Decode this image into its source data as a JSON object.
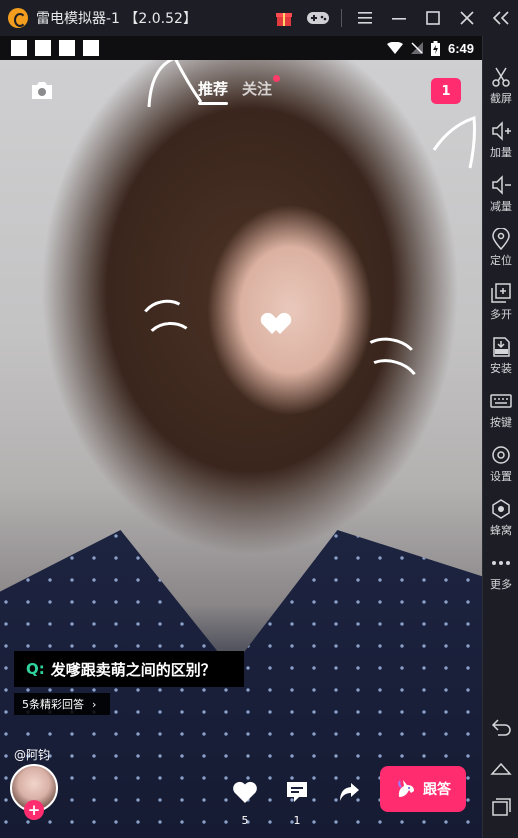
{
  "window": {
    "title": "雷电模拟器-1 【2.0.52】",
    "buttons": [
      "gift-icon",
      "gamepad-icon",
      "menu-icon",
      "minimize-icon",
      "maximize-icon",
      "close-icon"
    ],
    "collapse_icon": "double-chevron-left-icon"
  },
  "statusbar": {
    "time": "6:49",
    "notification_count": 4
  },
  "feed": {
    "tabs": [
      {
        "label": "推荐",
        "active": true
      },
      {
        "label": "关注",
        "active": false,
        "has_dot": true
      }
    ],
    "message_badge": "1"
  },
  "question": {
    "prefix": "Q:",
    "text": "发嗲跟卖萌之间的区别？",
    "answers_link": "5条精彩回答"
  },
  "author": {
    "name": "@阿钧"
  },
  "actions": {
    "like_count": "5",
    "comment_count": "1",
    "answer_label": "跟答"
  },
  "sidebar": {
    "items": [
      {
        "label": "截屏",
        "icon": "scissors-icon"
      },
      {
        "label": "加量",
        "icon": "volume-up-icon"
      },
      {
        "label": "减量",
        "icon": "volume-down-icon"
      },
      {
        "label": "定位",
        "icon": "location-icon"
      },
      {
        "label": "多开",
        "icon": "multi-open-icon"
      },
      {
        "label": "安装",
        "icon": "apk-install-icon"
      },
      {
        "label": "按键",
        "icon": "keyboard-icon"
      },
      {
        "label": "设置",
        "icon": "settings-gear-icon"
      },
      {
        "label": "蜂窝",
        "icon": "hive-icon"
      },
      {
        "label": "更多",
        "icon": "more-dots-icon"
      }
    ],
    "nav": [
      "back-icon",
      "home-icon",
      "recents-icon"
    ]
  },
  "colors": {
    "accent": "#ff2d6f",
    "question_green": "#2fd39b",
    "emulator_chrome": "#1d1e25"
  }
}
